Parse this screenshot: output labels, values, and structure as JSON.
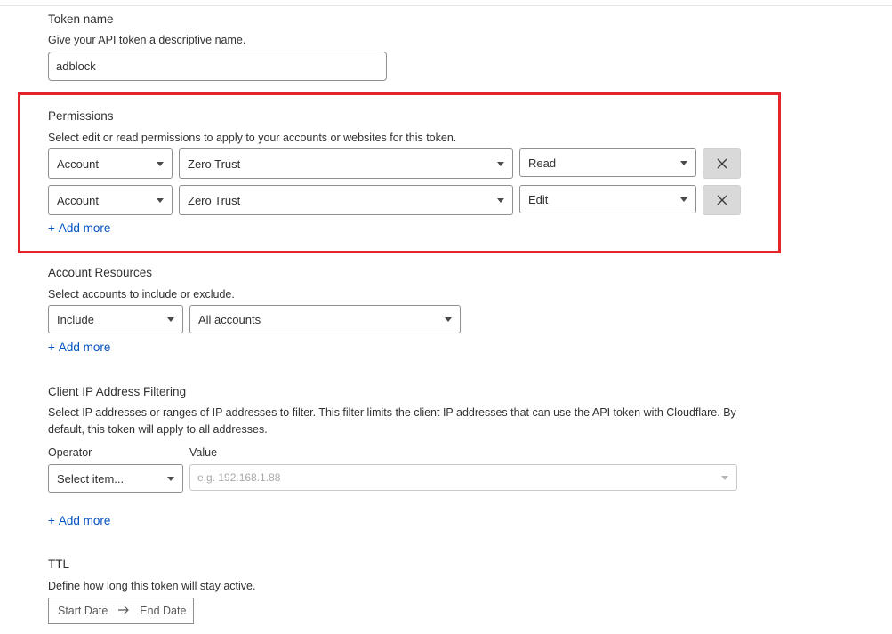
{
  "token_name": {
    "heading": "Token name",
    "description": "Give your API token a descriptive name.",
    "value": "adblock"
  },
  "permissions": {
    "heading": "Permissions",
    "description": "Select edit or read permissions to apply to your accounts or websites for this token.",
    "rows": [
      {
        "scope": "Account",
        "resource": "Zero Trust",
        "access": "Read"
      },
      {
        "scope": "Account",
        "resource": "Zero Trust",
        "access": "Edit"
      }
    ],
    "add_more": "Add more",
    "highlight_color": "#e3242b"
  },
  "account_resources": {
    "heading": "Account Resources",
    "description": "Select accounts to include or exclude.",
    "mode": "Include",
    "accounts": "All accounts",
    "add_more": "Add more"
  },
  "ip_filtering": {
    "heading": "Client IP Address Filtering",
    "description": "Select IP addresses or ranges of IP addresses to filter. This filter limits the client IP addresses that can use the API token with Cloudflare. By default, this token will apply to all addresses.",
    "operator_label": "Operator",
    "operator_value": "Select item...",
    "value_label": "Value",
    "value_placeholder": "e.g. 192.168.1.88",
    "add_more": "Add more"
  },
  "ttl": {
    "heading": "TTL",
    "description": "Define how long this token will stay active.",
    "start_placeholder": "Start Date",
    "end_placeholder": "End Date"
  },
  "colors": {
    "link": "#0051c3",
    "border": "#8f8f8f",
    "button_bg": "#d9d9d9"
  },
  "icons": {
    "remove": "close-icon",
    "dropdown": "chevron-down-icon",
    "range": "arrow-right-icon",
    "add": "plus-icon"
  }
}
